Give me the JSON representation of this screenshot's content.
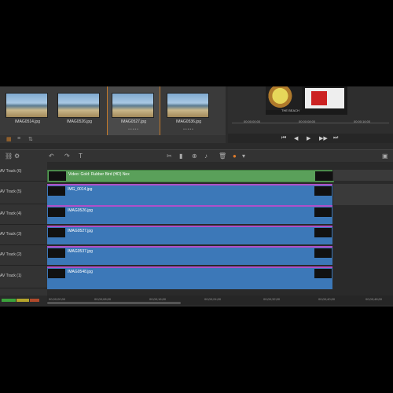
{
  "library": {
    "thumbnails": [
      {
        "label": "IMAG0514.jpg",
        "selected": false
      },
      {
        "label": "IMAG0526.jpg",
        "selected": false
      },
      {
        "label": "IMAG0527.jpg",
        "selected": true
      },
      {
        "label": "IMAG0536.jpg",
        "selected": false
      }
    ],
    "rating_dots": "•••••"
  },
  "monitor": {
    "caption": "THE BEACH",
    "timecodes": [
      "00;00;00;00",
      "00;00;08;00",
      "00;00;16;00"
    ],
    "transport": [
      "⏮",
      "◀",
      "▶",
      "▶▶",
      "⏭"
    ]
  },
  "tracks": [
    {
      "name": "AV Track (6)",
      "clip": "Video: Gold: Rubber Bird (HD) Nex",
      "color": "green"
    },
    {
      "name": "AV Track (5)",
      "clip": "IMG_0014.jpg",
      "color": "blue"
    },
    {
      "name": "AV Track (4)",
      "clip": "IMAG0526.jpg",
      "color": "blue"
    },
    {
      "name": "AV Track (3)",
      "clip": "IMAG0527.jpg",
      "color": "blue"
    },
    {
      "name": "AV Track (2)",
      "clip": "IMAG0537.jpg",
      "color": "blue"
    },
    {
      "name": "AV Track (1)",
      "clip": "IMAG0548.jpg",
      "color": "blue"
    }
  ],
  "ruler": {
    "ticks": [
      "00;00;00;00",
      "00;00;08;00",
      "00;00;16;00",
      "00;00;24;00",
      "00;00;32;00",
      "00;00;40;00",
      "00;00;48;00"
    ]
  }
}
